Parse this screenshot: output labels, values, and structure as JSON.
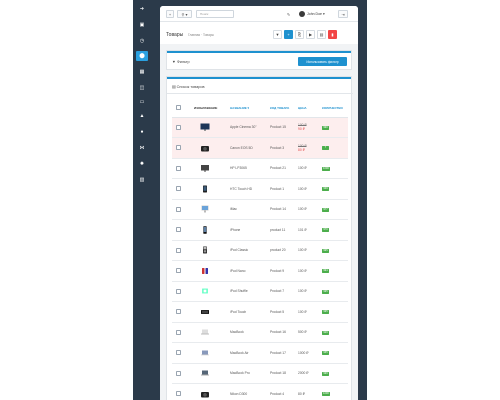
{
  "sidebar": {
    "items": [
      {
        "icon": "arrow-right-icon",
        "glyph": "➜"
      },
      {
        "icon": "dashboard-icon",
        "glyph": "▣"
      },
      {
        "icon": "catalog-icon",
        "glyph": "◷"
      },
      {
        "icon": "tag-icon",
        "glyph": "⬤",
        "active": true
      },
      {
        "icon": "puzzle-icon",
        "glyph": "▦"
      },
      {
        "icon": "design-icon",
        "glyph": "◫"
      },
      {
        "icon": "desktop-icon",
        "glyph": "▭"
      },
      {
        "icon": "cart-icon",
        "glyph": "▲"
      },
      {
        "icon": "user-icon",
        "glyph": "●"
      },
      {
        "icon": "share-icon",
        "glyph": "⋈"
      },
      {
        "icon": "cog-icon",
        "glyph": "✹"
      },
      {
        "icon": "chart-icon",
        "glyph": "▥"
      }
    ]
  },
  "topbar": {
    "add_glyph": "+",
    "search_dropdown_glyph": "⚲ ▾",
    "search_placeholder": "Поиск",
    "username": "John Doe ▾",
    "logout_glyph": "⇥",
    "brush_glyph": "✎"
  },
  "page": {
    "title": "Товары",
    "breadcrumb": "Главная · Товары",
    "header_buttons": [
      {
        "name": "filter-toggle-button",
        "glyph": "▼",
        "style": ""
      },
      {
        "name": "add-product-button",
        "glyph": "+",
        "style": "blue"
      },
      {
        "name": "copy-button",
        "glyph": "⎘",
        "style": ""
      },
      {
        "name": "play-button",
        "glyph": "▶",
        "style": ""
      },
      {
        "name": "save-button",
        "glyph": "▤",
        "style": ""
      },
      {
        "name": "delete-button",
        "glyph": "▮",
        "style": "red"
      }
    ]
  },
  "filter": {
    "label": "Фильтр",
    "button_label": "Использовать фильтр"
  },
  "product_list": {
    "label": "Список товаров",
    "columns": {
      "image": "Изображение",
      "name": "Название ▾",
      "model": "Код товара",
      "price": "Цена",
      "quantity": "Количество"
    },
    "rows": [
      {
        "name": "Apple Cinema 30\"",
        "model": "Product 15",
        "price": "100 ₽",
        "special": "90 ₽",
        "qty": "990",
        "warn": true,
        "thumb": "monitor"
      },
      {
        "name": "Canon EOS 5D",
        "model": "Product 3",
        "price": "100 ₽",
        "special": "80 ₽",
        "qty": "7",
        "warn": true,
        "thumb": "camera"
      },
      {
        "name": "HP LP3065",
        "model": "Product 21",
        "price": "100 ₽",
        "special": "",
        "qty": "1000",
        "warn": false,
        "thumb": "monitor2"
      },
      {
        "name": "HTC Touch HD",
        "model": "Product 1",
        "price": "100 ₽",
        "special": "",
        "qty": "939",
        "warn": false,
        "thumb": "phone"
      },
      {
        "name": "iMac",
        "model": "Product 14",
        "price": "100 ₽",
        "special": "",
        "qty": "977",
        "warn": false,
        "thumb": "imac"
      },
      {
        "name": "iPhone",
        "model": "product 11",
        "price": "101 ₽",
        "special": "",
        "qty": "970",
        "warn": false,
        "thumb": "iphone"
      },
      {
        "name": "iPod Classic",
        "model": "product 20",
        "price": "100 ₽",
        "special": "",
        "qty": "995",
        "warn": false,
        "thumb": "ipod"
      },
      {
        "name": "iPod Nano",
        "model": "Product 9",
        "price": "100 ₽",
        "special": "",
        "qty": "994",
        "warn": false,
        "thumb": "nano"
      },
      {
        "name": "iPod Shuffle",
        "model": "Product 7",
        "price": "100 ₽",
        "special": "",
        "qty": "995",
        "warn": false,
        "thumb": "shuffle"
      },
      {
        "name": "iPod Touch",
        "model": "Product 5",
        "price": "100 ₽",
        "special": "",
        "qty": "995",
        "warn": false,
        "thumb": "touch"
      },
      {
        "name": "MacBook",
        "model": "Product 16",
        "price": "500 ₽",
        "special": "",
        "qty": "929",
        "warn": false,
        "thumb": "macbook"
      },
      {
        "name": "MacBook Air",
        "model": "Product 17",
        "price": "1000 ₽",
        "special": "",
        "qty": "965",
        "warn": false,
        "thumb": "air"
      },
      {
        "name": "MacBook Pro",
        "model": "Product 18",
        "price": "2000 ₽",
        "special": "",
        "qty": "999",
        "warn": false,
        "thumb": "pro"
      },
      {
        "name": "Nikon D300",
        "model": "Product 4",
        "price": "80 ₽",
        "special": "",
        "qty": "1000",
        "warn": false,
        "thumb": "camera"
      }
    ]
  },
  "colors": {
    "accent": "#1e91cf",
    "danger": "#f24545",
    "success": "#4cae4c",
    "sidebar": "#2b3a4a"
  }
}
